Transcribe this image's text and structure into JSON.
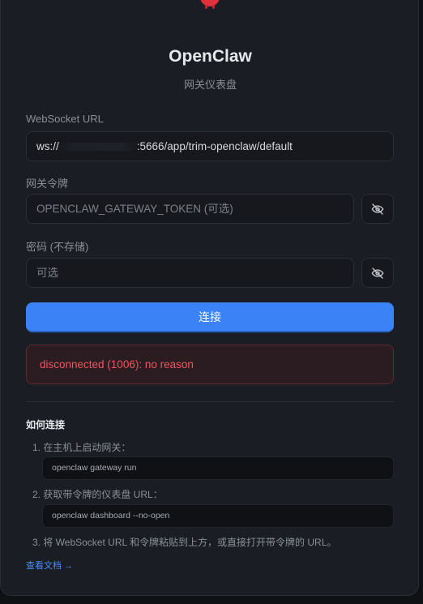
{
  "app": {
    "title": "OpenClaw",
    "subtitle": "网关仪表盘",
    "logo_icon": "red-lobster-mascot-icon"
  },
  "form": {
    "ws_url_label": "WebSocket URL",
    "ws_url_prefix": "ws://",
    "ws_url_suffix": ":5666/app/trim-openclaw/default",
    "token_label": "网关令牌",
    "token_placeholder": "OPENCLAW_GATEWAY_TOKEN (可选)",
    "password_label": "密码 (不存储)",
    "password_placeholder": "可选",
    "toggle_icon": "eye-off-icon",
    "connect_label": "连接"
  },
  "status": {
    "error_text": "disconnected (1006): no reason",
    "error_color": "#f0555f"
  },
  "help": {
    "title": "如何连接",
    "step1": "1. 在主机上启动网关：",
    "code1": "openclaw gateway run",
    "step2": "2. 获取带令牌的仪表盘 URL：",
    "code2": "openclaw dashboard --no-open",
    "step3": "3. 将 WebSocket URL 和令牌粘贴到上方，或直接打开带令牌的 URL。",
    "docs_link": "查看文档 →"
  },
  "colors": {
    "accent": "#3b82f6",
    "card_bg": "#1a1d23",
    "page_bg": "#0f1115"
  }
}
